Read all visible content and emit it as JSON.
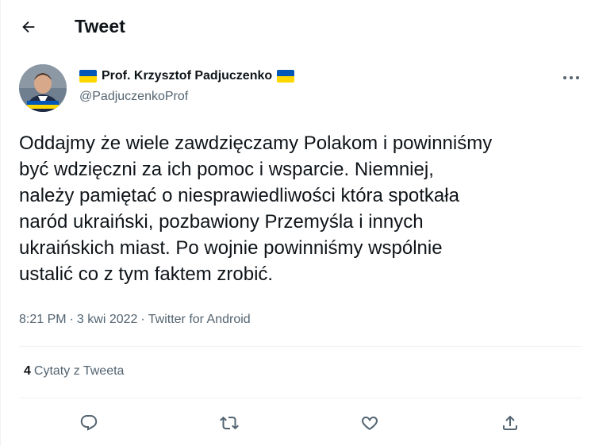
{
  "header": {
    "title": "Tweet"
  },
  "author": {
    "display_name": "Prof. Krzysztof Padjuczenko",
    "handle": "@PadjuczenkoProf"
  },
  "tweet": {
    "text": "Oddajmy że wiele zawdzięczamy Polakom i powinniśmy\nbyć wdzięczni za ich pomoc i wsparcie. Niemniej,\nnależy pamiętać o niesprawiedliwości która spotkała\nnaród ukraiński, pozbawiony Przemyśla i innych\nukraińskich miast. Po wojnie powinniśmy wspólnie\nustalić co z tym faktem zrobić.",
    "time": "8:21 PM",
    "date": "3 kwi 2022",
    "source": "Twitter for Android",
    "separator": "·"
  },
  "stats": {
    "quotes_count": "4",
    "quotes_label": "Cytaty z Tweeta"
  },
  "colors": {
    "flag_blue": "#0057b7",
    "flag_yellow": "#ffd700",
    "secondary_text": "#536471",
    "primary_text": "#0f1419"
  },
  "icons": {
    "back": "arrow-left-icon",
    "more": "more-dots-icon",
    "reply": "reply-icon",
    "retweet": "retweet-icon",
    "like": "heart-icon",
    "share": "share-icon"
  }
}
